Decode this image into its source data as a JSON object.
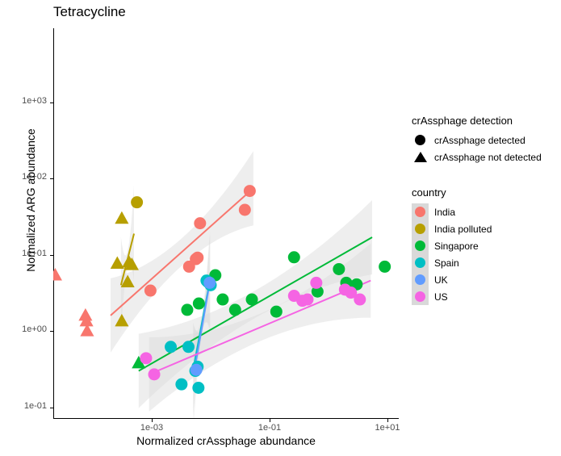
{
  "chart_data": {
    "type": "scatter",
    "title": "Tetracycline",
    "xlabel": "Normalized crAssphage abundance",
    "ylabel": "Normalized ARG abundance",
    "xscale": "log10",
    "yscale": "log10",
    "xlim": [
      1e-05,
      25
    ],
    "ylim": [
      0.1,
      5000
    ],
    "xticks": [
      "1e-03",
      "1e-01",
      "1e+01"
    ],
    "xtick_values": [
      0.001,
      0.1,
      10
    ],
    "yticks": [
      "1e-01",
      "1e+00",
      "1e+01",
      "1e+02",
      "1e+03"
    ],
    "ytick_values": [
      0.1,
      1,
      10,
      100,
      1000
    ],
    "grid": false,
    "legend_position": "right",
    "legends": [
      {
        "title": "crAssphage detection",
        "name": "shape",
        "entries": [
          {
            "label": "crAssphage detected",
            "shape": "circle"
          },
          {
            "label": "crAssphage not detected",
            "shape": "triangle"
          }
        ]
      },
      {
        "title": "country",
        "name": "colour",
        "entries": [
          {
            "label": "India",
            "color": "#F8766D"
          },
          {
            "label": "India polluted",
            "color": "#B79F00"
          },
          {
            "label": "Singapore",
            "color": "#00BA38"
          },
          {
            "label": "Spain",
            "color": "#00BFC4"
          },
          {
            "label": "UK",
            "color": "#619CFF"
          },
          {
            "label": "US",
            "color": "#F564E3"
          }
        ]
      }
    ],
    "series": [
      {
        "name": "India",
        "color": "#F8766D",
        "points": [
          {
            "x": 2.3e-05,
            "y": 5.4,
            "shape": "triangle"
          },
          {
            "x": 7.5e-05,
            "y": 1.6,
            "shape": "triangle"
          },
          {
            "x": 7.8e-05,
            "y": 1.35,
            "shape": "triangle"
          },
          {
            "x": 8e-05,
            "y": 1.0,
            "shape": "triangle"
          },
          {
            "x": 0.00095,
            "y": 3.4,
            "shape": "circle"
          },
          {
            "x": 0.0043,
            "y": 7.0,
            "shape": "circle"
          },
          {
            "x": 0.0056,
            "y": 8.8,
            "shape": "circle"
          },
          {
            "x": 0.006,
            "y": 9.2,
            "shape": "circle"
          },
          {
            "x": 0.0066,
            "y": 26.0,
            "shape": "circle"
          },
          {
            "x": 0.038,
            "y": 39.0,
            "shape": "circle"
          },
          {
            "x": 0.046,
            "y": 69.0,
            "shape": "circle"
          }
        ],
        "trend": {
          "x1": 0.0002,
          "y1": 1.6,
          "x2": 0.053,
          "y2": 75.0
        }
      },
      {
        "name": "India polluted",
        "color": "#B79F00",
        "points": [
          {
            "x": 0.00031,
            "y": 30.0,
            "shape": "triangle"
          },
          {
            "x": 0.00026,
            "y": 7.7,
            "shape": "triangle"
          },
          {
            "x": 0.00041,
            "y": 8.0,
            "shape": "triangle"
          },
          {
            "x": 0.00046,
            "y": 7.4,
            "shape": "triangle"
          },
          {
            "x": 0.00039,
            "y": 4.4,
            "shape": "triangle"
          },
          {
            "x": 0.00031,
            "y": 1.35,
            "shape": "triangle"
          },
          {
            "x": 0.00056,
            "y": 49.0,
            "shape": "circle"
          }
        ],
        "trend": {
          "x1": 0.0003,
          "y1": 4.0,
          "x2": 0.0005,
          "y2": 19.0
        }
      },
      {
        "name": "Singapore",
        "color": "#00BA38",
        "points": [
          {
            "x": 0.0006,
            "y": 0.38,
            "shape": "triangle"
          },
          {
            "x": 0.004,
            "y": 1.9,
            "shape": "circle"
          },
          {
            "x": 0.0063,
            "y": 2.3,
            "shape": "circle"
          },
          {
            "x": 0.012,
            "y": 5.4,
            "shape": "circle"
          },
          {
            "x": 0.016,
            "y": 2.6,
            "shape": "circle"
          },
          {
            "x": 0.026,
            "y": 1.9,
            "shape": "circle"
          },
          {
            "x": 0.05,
            "y": 2.6,
            "shape": "circle"
          },
          {
            "x": 0.13,
            "y": 1.8,
            "shape": "circle"
          },
          {
            "x": 0.26,
            "y": 9.3,
            "shape": "circle"
          },
          {
            "x": 0.65,
            "y": 3.3,
            "shape": "circle"
          },
          {
            "x": 1.5,
            "y": 6.5,
            "shape": "circle"
          },
          {
            "x": 2.0,
            "y": 4.3,
            "shape": "circle"
          },
          {
            "x": 3.0,
            "y": 4.1,
            "shape": "circle"
          },
          {
            "x": 9.0,
            "y": 7.0,
            "shape": "circle"
          }
        ],
        "trend": {
          "x1": 0.0006,
          "y1": 0.3,
          "x2": 5.5,
          "y2": 17.0
        }
      },
      {
        "name": "Spain",
        "color": "#00BFC4",
        "points": [
          {
            "x": 0.0021,
            "y": 0.62,
            "shape": "circle"
          },
          {
            "x": 0.0032,
            "y": 0.2,
            "shape": "circle"
          },
          {
            "x": 0.0042,
            "y": 0.62,
            "shape": "circle"
          },
          {
            "x": 0.0055,
            "y": 0.3,
            "shape": "circle"
          },
          {
            "x": 0.006,
            "y": 0.34,
            "shape": "circle"
          },
          {
            "x": 0.0062,
            "y": 0.18,
            "shape": "circle"
          },
          {
            "x": 0.0085,
            "y": 4.6,
            "shape": "circle"
          },
          {
            "x": 0.009,
            "y": 4.4,
            "shape": "circle"
          },
          {
            "x": 0.0096,
            "y": 4.3,
            "shape": "circle"
          },
          {
            "x": 0.01,
            "y": 4.0,
            "shape": "circle"
          }
        ],
        "trend": {
          "x1": 0.005,
          "y1": 0.3,
          "x2": 0.0096,
          "y2": 4.4
        }
      },
      {
        "name": "UK",
        "color": "#619CFF",
        "points": [
          {
            "x": 0.0057,
            "y": 0.31,
            "shape": "circle"
          },
          {
            "x": 0.0096,
            "y": 4.3,
            "shape": "circle"
          }
        ],
        "trend": {
          "x1": 0.0052,
          "y1": 0.28,
          "x2": 0.0098,
          "y2": 4.6
        }
      },
      {
        "name": "US",
        "color": "#F564E3",
        "points": [
          {
            "x": 0.0008,
            "y": 0.44,
            "shape": "circle"
          },
          {
            "x": 0.0011,
            "y": 0.27,
            "shape": "circle"
          },
          {
            "x": 0.26,
            "y": 2.9,
            "shape": "circle"
          },
          {
            "x": 0.36,
            "y": 2.5,
            "shape": "circle"
          },
          {
            "x": 0.44,
            "y": 2.6,
            "shape": "circle"
          },
          {
            "x": 0.62,
            "y": 4.3,
            "shape": "circle"
          },
          {
            "x": 1.9,
            "y": 3.5,
            "shape": "circle"
          },
          {
            "x": 2.4,
            "y": 3.2,
            "shape": "circle"
          },
          {
            "x": 3.4,
            "y": 2.6,
            "shape": "circle"
          }
        ],
        "trend": {
          "x1": 0.0009,
          "y1": 0.27,
          "x2": 5.2,
          "y2": 4.6
        }
      }
    ],
    "ribbon_color": "#d9d9d9",
    "ribbon_opacity": 0.45
  }
}
